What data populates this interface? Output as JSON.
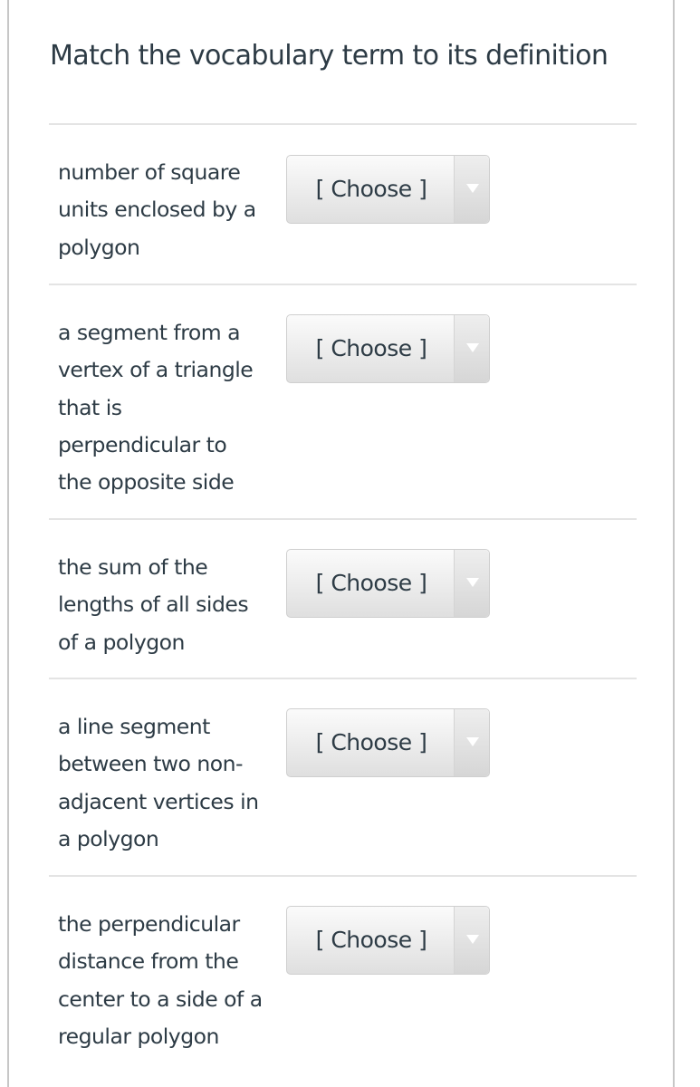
{
  "question": {
    "title": "Match the vocabulary term to its definition"
  },
  "rows": [
    {
      "definition": [
        "number of square",
        "units enclosed by a",
        "polygon"
      ],
      "select_label": "[ Choose ]"
    },
    {
      "definition": [
        "a segment from a",
        "vertex of a triangle",
        "that is",
        "perpendicular to",
        "the opposite side"
      ],
      "select_label": "[ Choose ]"
    },
    {
      "definition": [
        "the sum of the",
        "lengths of all sides",
        "of a polygon"
      ],
      "select_label": "[ Choose ]"
    },
    {
      "definition": [
        "a line segment",
        "between two non-",
        "adjacent vertices in",
        "a polygon"
      ],
      "select_label": "[ Choose ]"
    },
    {
      "definition": [
        "the perpendicular",
        "distance from the",
        "center to a side of a",
        "regular polygon"
      ],
      "select_label": "[ Choose ]"
    }
  ],
  "icons": {
    "dropdown": "triangle-down-icon"
  }
}
